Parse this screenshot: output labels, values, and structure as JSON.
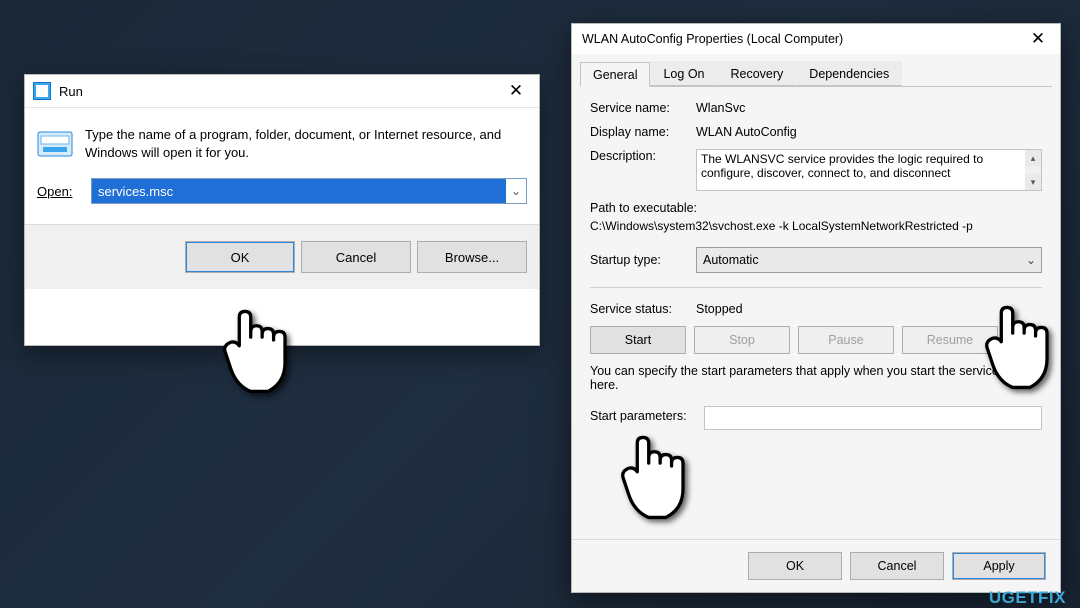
{
  "run": {
    "title": "Run",
    "instructions": "Type the name of a program, folder, document, or Internet resource, and Windows will open it for you.",
    "open_label_prefix": "O",
    "open_label_rest": "pen:",
    "input_value": "services.msc",
    "buttons": {
      "ok": "OK",
      "cancel": "Cancel",
      "browse": "Browse..."
    }
  },
  "props": {
    "title": "WLAN AutoConfig Properties (Local Computer)",
    "tabs": {
      "general": "General",
      "logon": "Log On",
      "recovery": "Recovery",
      "deps": "Dependencies"
    },
    "labels": {
      "service_name": "Service name:",
      "display_name": "Display name:",
      "description": "Description:",
      "path": "Path to executable:",
      "startup_type": "Startup type:",
      "service_status": "Service status:",
      "start_params": "Start parameters:",
      "note": "You can specify the start parameters that apply when you start the service from here."
    },
    "values": {
      "service_name": "WlanSvc",
      "display_name": "WLAN AutoConfig",
      "description": "The WLANSVC service provides the logic required to configure, discover, connect to, and disconnect",
      "path": "C:\\Windows\\system32\\svchost.exe -k LocalSystemNetworkRestricted -p",
      "startup_type": "Automatic",
      "service_status": "Stopped"
    },
    "buttons": {
      "start": "Start",
      "stop": "Stop",
      "pause": "Pause",
      "resume": "Resume",
      "ok": "OK",
      "cancel": "Cancel",
      "apply": "Apply"
    }
  },
  "watermark": "UGETFIX"
}
